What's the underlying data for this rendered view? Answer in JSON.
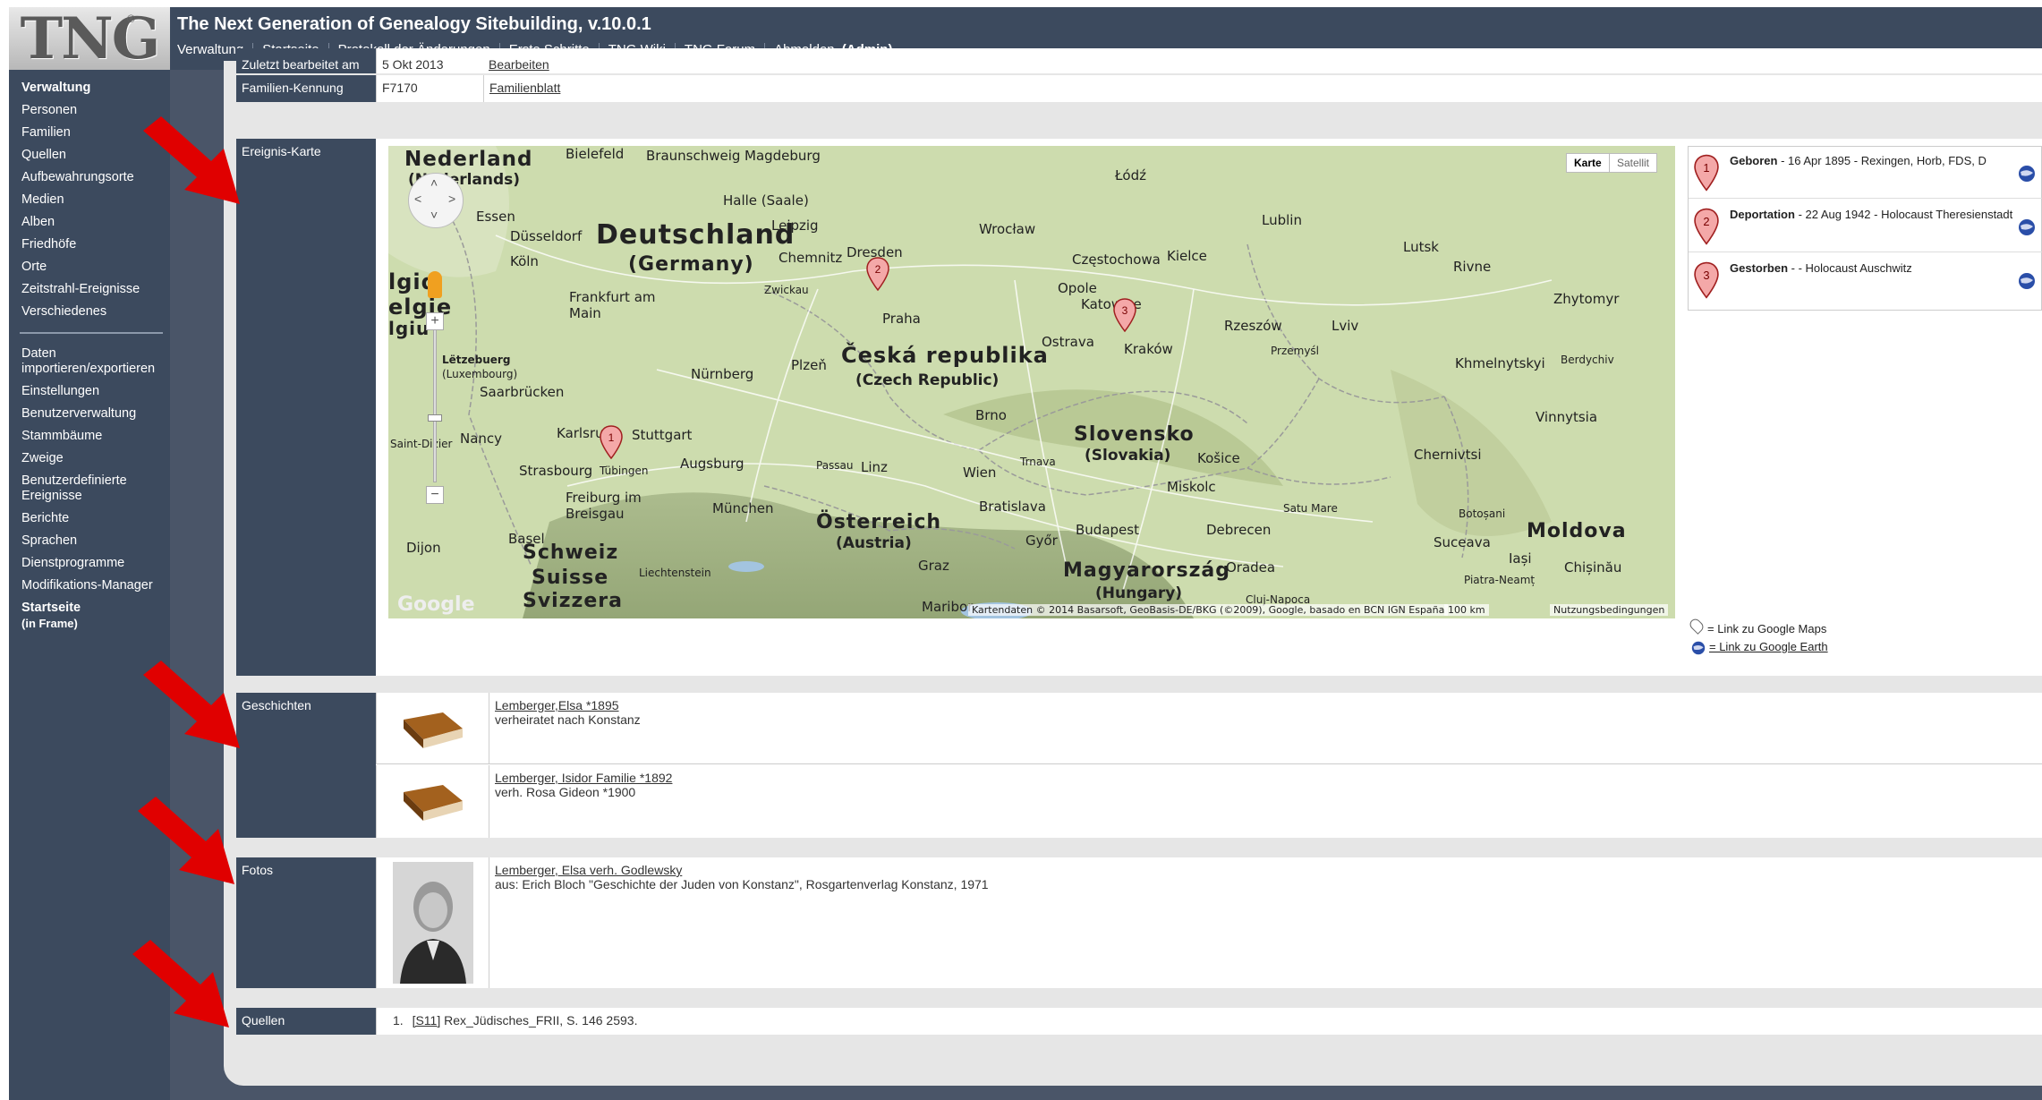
{
  "header": {
    "logo": "TNG",
    "title": "The Next Generation of Genealogy Sitebuilding, v.10.0.1",
    "nav": [
      "Verwaltung",
      "Startseite",
      "Protokoll der Änderungen",
      "Erste Schritte",
      "TNG Wiki",
      "TNG Forum",
      "Abmelden"
    ],
    "admin": "(Admin)"
  },
  "sidebar": {
    "group1": [
      "Verwaltung",
      "Personen",
      "Familien",
      "Quellen",
      "Aufbewahrungsorte",
      "Medien",
      "Alben",
      "Friedhöfe",
      "Orte",
      "Zeitstrahl-Ereignisse",
      "Verschiedenes"
    ],
    "group2": [
      "Daten importieren/exportieren",
      "Einstellungen",
      "Benutzerverwaltung",
      "Stammbäume",
      "Zweige",
      "Benutzerdefinierte Ereignisse",
      "Berichte",
      "Sprachen",
      "Dienstprogramme",
      "Modifikations-Manager"
    ],
    "startseite": "Startseite",
    "startseite_sub": "(in Frame)"
  },
  "top_rows": {
    "last_modified_label": "Zuletzt bearbeitet am",
    "last_modified_value": "5 Okt 2013",
    "last_modified_link": "Bearbeiten",
    "family_id_label": "Familien-Kennung",
    "family_id_value": "F7170",
    "family_sheet_link": "Familienblatt"
  },
  "event_map": {
    "label": "Ereignis-Karte",
    "btn_map": "Karte",
    "btn_satellite": "Satellit",
    "attribution": "Kartendaten © 2014 Basarsoft, GeoBasis-DE/BKG (©2009), Google, basado en BCN IGN España",
    "scale": "100 km",
    "terms": "Nutzungsbedingungen",
    "google": "Google",
    "labels": {
      "nederland": "Nederland",
      "nederland_sub": "(Nederlands)",
      "deutschland": "Deutschland",
      "germany": "(Germany)",
      "ceska": "Česká republika",
      "czech": "(Czech Republic)",
      "slovensko": "Slovensko",
      "slovakia": "(Slovakia)",
      "osterreich": "Österreich",
      "austria": "(Austria)",
      "schweiz": "Schweiz",
      "suisse": "Suisse",
      "svizzera": "Svizzera",
      "magyar": "Magyarország",
      "hungary": "(Hungary)",
      "moldova": "Moldova",
      "belgique": "lgiq",
      "belgie": "elgie",
      "belgium": "lgiu",
      "letzebuerg": "Lëtzebuerg",
      "luxembourg": "(Luxembourg)"
    },
    "cities": [
      "Bielefeld",
      "Braunschweig",
      "Magdeburg",
      "Łódź",
      "Essen",
      "Halle (Saale)",
      "Düsseldorf",
      "Leipzig",
      "Lublin",
      "Köln",
      "Chemnitz",
      "Dresden",
      "Wrocław",
      "Częstochowa",
      "Kielce",
      "Lutsk",
      "Rivne",
      "Zwickau",
      "Opole",
      "Frankfurt am Main",
      "Praha",
      "Katowice",
      "Rzeszów",
      "Lviv",
      "Zhytomyr",
      "Plzeň",
      "Ostrava",
      "Kraków",
      "Przemyśl",
      "Nürnberg",
      "Saarbrücken",
      "Khmelnytskyi",
      "Berdychiv",
      "Brno",
      "Vinnytsia",
      "Karlsruhe",
      "Stuttgart",
      "Nancy",
      "Strasbourg",
      "Tübingen",
      "Augsburg",
      "Passau",
      "Linz",
      "Wien",
      "Trnava",
      "Košice",
      "Chernivtsi",
      "Freiburg im Breisgau",
      "München",
      "Bratislava",
      "Miskolc",
      "Basel",
      "Győr",
      "Budapest",
      "Debrecen",
      "Satu Mare",
      "Botoșani",
      "Suceava",
      "Dijon",
      "Liechtenstein",
      "Graz",
      "Oradea",
      "Iași",
      "Chișinău",
      "Maribor",
      "Piatra-Neamț",
      "Cluj-Napoca",
      "Saint-Dizier"
    ],
    "pins": [
      "1",
      "2",
      "3"
    ]
  },
  "events": [
    {
      "num": "1",
      "type": "Geboren",
      "detail": " - 16 Apr 1895 - Rexingen, Horb, FDS, D"
    },
    {
      "num": "2",
      "type": "Deportation",
      "detail": " - 22 Aug 1942 - Holocaust Theresienstadt"
    },
    {
      "num": "3",
      "type": "Gestorben",
      "detail": " - - Holocaust Auschwitz"
    }
  ],
  "legend": {
    "maps": "= Link zu Google Maps",
    "earth": "= Link zu Google Earth"
  },
  "stories": {
    "label": "Geschichten",
    "items": [
      {
        "title": "Lemberger,Elsa *1895",
        "desc": "verheiratet nach Konstanz"
      },
      {
        "title": "Lemberger, Isidor Familie *1892",
        "desc": "verh. Rosa Gideon *1900"
      }
    ]
  },
  "photos": {
    "label": "Fotos",
    "title": "Lemberger, Elsa verh. Godlewsky",
    "desc": "aus: Erich Bloch \"Geschichte der Juden von Konstanz\", Rosgartenverlag Konstanz, 1971"
  },
  "sources": {
    "label": "Quellen",
    "num": "1.",
    "link": "[S11]",
    "text": " Rex_Jüdisches_FRII, S. 146 2593."
  },
  "colors": {
    "nav_bg": "#3c4a5e",
    "arrow": "#e00000",
    "map_bg": "#c9d8ac"
  }
}
